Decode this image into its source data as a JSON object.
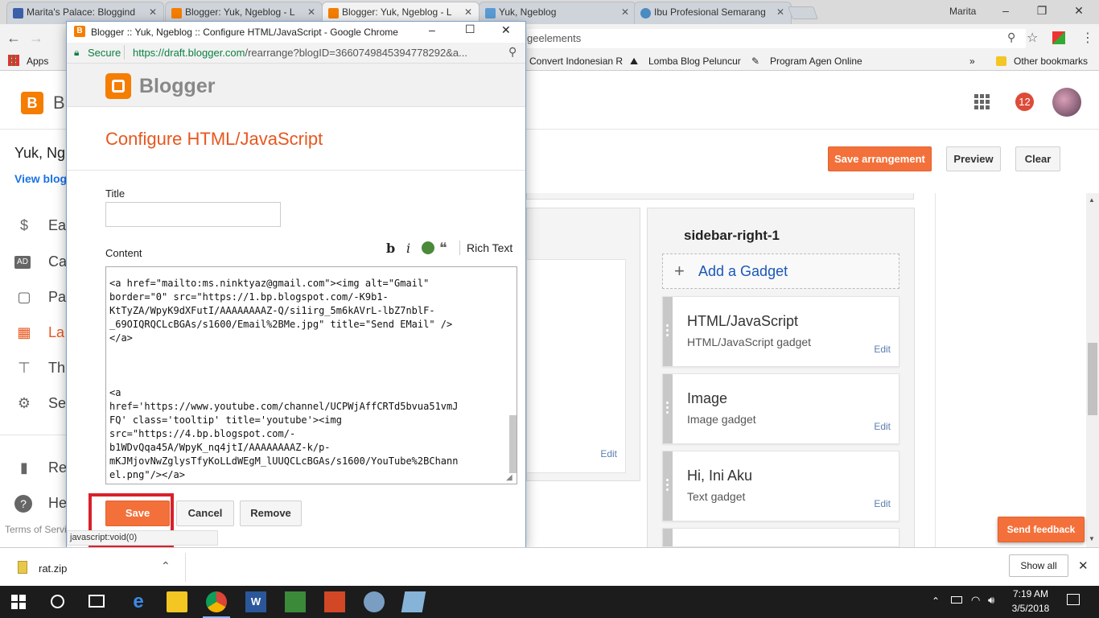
{
  "browser_tabs": [
    {
      "title": "Marita's Palace: Bloggind",
      "favicon_color": "#3a5ea8",
      "active": false
    },
    {
      "title": "Blogger: Yuk, Ngeblog - L",
      "favicon_color": "#f57d00",
      "active": false
    },
    {
      "title": "Blogger: Yuk, Ngeblog - L",
      "favicon_color": "#f57d00",
      "active": true
    },
    {
      "title": "Yuk, Ngeblog",
      "favicon_color": "#5a9bd5",
      "active": false
    },
    {
      "title": "Ibu Profesional Semarang",
      "favicon_color": "#4a8bc2",
      "active": false
    }
  ],
  "browser": {
    "user": "Marita",
    "url_tail": "geelements",
    "apps_label": "Apps",
    "bookmarks": [
      "Convert Indonesian R",
      "Lomba Blog Peluncur",
      "Program Agen Online"
    ],
    "other_bookmarks": "Other bookmarks"
  },
  "blogger_bg": {
    "logo_letter": "B",
    "blog_title": "Yuk, Ng",
    "view_blog": "View blog",
    "notifications": "12",
    "save_arrangement": "Save arrangement",
    "preview": "Preview",
    "clear": "Clear",
    "sidebar": [
      {
        "icon": "dollar-icon",
        "glyph": "$",
        "label": "Ea"
      },
      {
        "icon": "ads-icon",
        "glyph": "AD",
        "label": "Ca"
      },
      {
        "icon": "pages-icon",
        "glyph": "▢",
        "label": "Pa"
      },
      {
        "icon": "layout-icon",
        "glyph": "▦",
        "label": "La"
      },
      {
        "icon": "theme-icon",
        "glyph": "⊤",
        "label": "Th"
      },
      {
        "icon": "settings-icon",
        "glyph": "⚙",
        "label": "Se"
      }
    ],
    "reading_list": "Re",
    "help": "He",
    "terms": "Terms of Servi",
    "sidebar_section_title": "sidebar-right-1",
    "add_gadget": "Add a Gadget",
    "left_edit": "Edit",
    "gadgets": [
      {
        "title": "HTML/JavaScript",
        "subtitle": "HTML/JavaScript gadget",
        "edit": "Edit"
      },
      {
        "title": "Image",
        "subtitle": "Image gadget",
        "edit": "Edit"
      },
      {
        "title": "Hi, Ini Aku",
        "subtitle": "Text gadget",
        "edit": "Edit"
      }
    ],
    "send_feedback": "Send feedback"
  },
  "popup": {
    "window_title": "Blogger :: Yuk, Ngeblog :: Configure HTML/JavaScript - Google Chrome",
    "secure_label": "Secure",
    "url_prefix": "https://draft.",
    "url_host": "blogger.com",
    "url_path": "/rearrange?blogID=3660749845394778292&a...",
    "brand": "Blogger",
    "heading": "Configure HTML/JavaScript",
    "title_label": "Title",
    "title_value": "",
    "content_label": "Content",
    "rich_text": "Rich Text",
    "toolbar_bold": "b",
    "toolbar_italic": "i",
    "code_lines": [
      "<a href=\"mailto:ms.ninktyaz@gmail.com\"><img alt=\"Gmail\"",
      "border=\"0\" src=\"https://1.bp.blogspot.com/-K9b1-",
      "KtTyZA/WpyK9dXFutI/AAAAAAAAZ-Q/si1irg_5m6kAVrL-lbZ7nblF-",
      "_69OIQRQCLcBGAs/s1600/Email%2BMe.jpg\" title=\"Send EMail\" />",
      "</a>",
      "",
      "",
      "",
      "<a",
      "href='https://www.youtube.com/channel/UCPWjAffCRTd5bvua51vmJ",
      "FQ' class='tooltip' title='youtube'><img",
      "src=\"https://4.bp.blogspot.com/-",
      "b1WDvQqa45A/WpyK_nq4jtI/AAAAAAAAZ-k/p-",
      "mKJMjovNwZglysTfyKoLLdWEgM_lUUQCLcBGAs/s1600/YouTube%2BChann",
      "el.png\"/></a>"
    ],
    "save": "Save",
    "cancel": "Cancel",
    "remove": "Remove",
    "status": "javascript:void(0)"
  },
  "download": {
    "file": "rat.zip",
    "show_all": "Show all"
  },
  "taskbar": {
    "time": "7:19 AM",
    "date": "3/5/2018"
  },
  "colors": {
    "accent": "#f4703a",
    "highlight_box": "#d9202a",
    "link": "#1a73e8"
  }
}
